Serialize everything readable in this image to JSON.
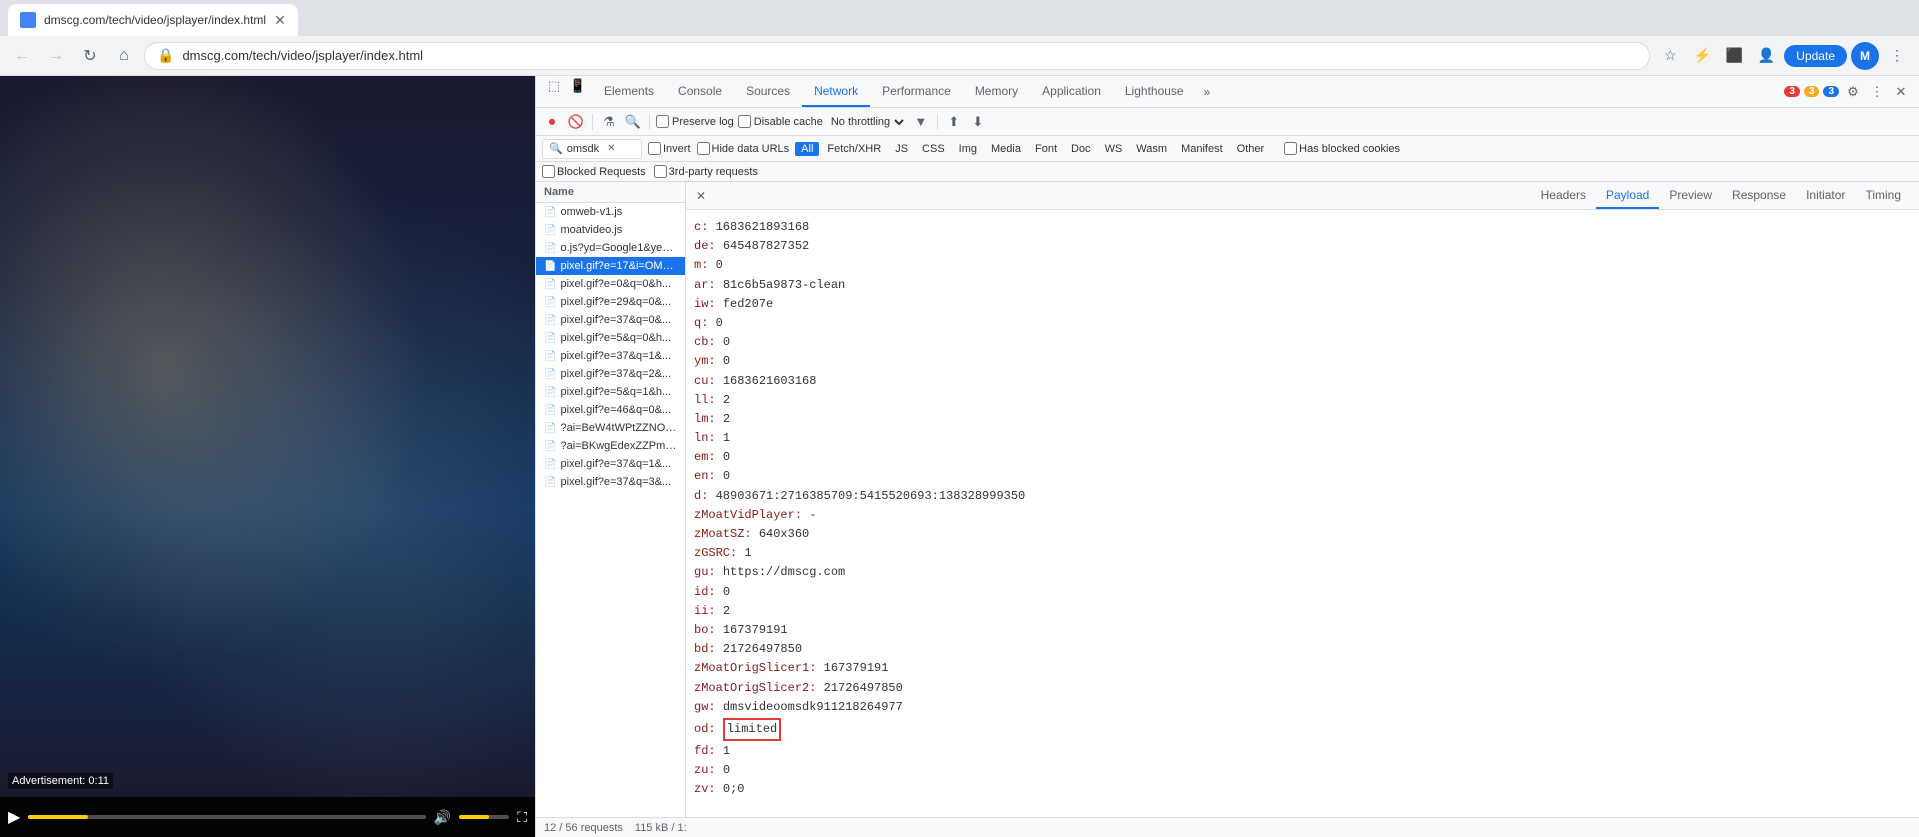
{
  "browser": {
    "tab_title": "dmscg.com/tech/video/jsplayer/index.html",
    "address": "dmscg.com/tech/video/jsplayer/index.html",
    "update_label": "Update",
    "avatar_initial": "M"
  },
  "devtools": {
    "tabs": [
      {
        "id": "elements",
        "label": "Elements",
        "active": false
      },
      {
        "id": "console",
        "label": "Console",
        "active": false
      },
      {
        "id": "sources",
        "label": "Sources",
        "active": false
      },
      {
        "id": "network",
        "label": "Network",
        "active": true
      },
      {
        "id": "performance",
        "label": "Performance",
        "active": false
      },
      {
        "id": "memory",
        "label": "Memory",
        "active": false
      },
      {
        "id": "application",
        "label": "Application",
        "active": false
      },
      {
        "id": "lighthouse",
        "label": "Lighthouse",
        "active": false
      }
    ],
    "toolbar": {
      "preserve_log": "Preserve log",
      "disable_cache": "Disable cache",
      "throttle": "No throttling",
      "blocked_requests": "Blocked Requests",
      "third_party": "3rd-party requests"
    },
    "filter": {
      "placeholder": "omsdk",
      "invert": "Invert",
      "hide_data_urls": "Hide data URLs",
      "filter_types": [
        "All",
        "Fetch/XHR",
        "JS",
        "CSS",
        "Img",
        "Media",
        "Font",
        "Doc",
        "WS",
        "Wasm",
        "Manifest",
        "Other"
      ],
      "active_filter": "All",
      "has_blocked": "Has blocked cookies"
    },
    "badges": {
      "errors": "3",
      "warnings": "3",
      "info": "3"
    },
    "file_list": {
      "header": "Name",
      "files": [
        {
          "name": "omweb-v1.js",
          "selected": false,
          "icon": "📄"
        },
        {
          "name": "moatvideo.js",
          "selected": false,
          "icon": "📄"
        },
        {
          "name": "o.js?yd=Google1&ye=...",
          "selected": false,
          "icon": "📄"
        },
        {
          "name": "pixel.gif?e=17&i=OMS...",
          "selected": true,
          "icon": "📄"
        },
        {
          "name": "pixel.gif?e=0&q=0&h...",
          "selected": false,
          "icon": "📄"
        },
        {
          "name": "pixel.gif?e=29&q=0&...",
          "selected": false,
          "icon": "📄"
        },
        {
          "name": "pixel.gif?e=37&q=0&...",
          "selected": false,
          "icon": "📄"
        },
        {
          "name": "pixel.gif?e=5&q=0&h...",
          "selected": false,
          "icon": "📄"
        },
        {
          "name": "pixel.gif?e=37&q=1&...",
          "selected": false,
          "icon": "📄"
        },
        {
          "name": "pixel.gif?e=37&q=2&...",
          "selected": false,
          "icon": "📄"
        },
        {
          "name": "pixel.gif?e=5&q=1&h...",
          "selected": false,
          "icon": "📄"
        },
        {
          "name": "pixel.gif?e=46&q=0&...",
          "selected": false,
          "icon": "📄"
        },
        {
          "name": "?ai=BeW4tWPtZZNOV...",
          "selected": false,
          "icon": "📄"
        },
        {
          "name": "?ai=BKwgEdexZZPmD...",
          "selected": false,
          "icon": "📄"
        },
        {
          "name": "pixel.gif?e=37&q=1&...",
          "selected": false,
          "icon": "📄"
        },
        {
          "name": "pixel.gif?e=37&q=3&...",
          "selected": false,
          "icon": "📄"
        }
      ]
    },
    "detail": {
      "tabs": [
        "Headers",
        "Payload",
        "Preview",
        "Response",
        "Initiator",
        "Timing"
      ],
      "active_tab": "Payload",
      "payload_data": [
        {
          "key": "c:",
          "value": "1683621893168"
        },
        {
          "key": "de:",
          "value": "645487827352"
        },
        {
          "key": "m:",
          "value": "0"
        },
        {
          "key": "ar:",
          "value": "81c6b5a9873-clean"
        },
        {
          "key": "iw:",
          "value": "fed207e"
        },
        {
          "key": "q:",
          "value": "0"
        },
        {
          "key": "cb:",
          "value": "0"
        },
        {
          "key": "ym:",
          "value": "0"
        },
        {
          "key": "cu:",
          "value": "1683621603168"
        },
        {
          "key": "ll:",
          "value": "2"
        },
        {
          "key": "lm:",
          "value": "2"
        },
        {
          "key": "ln:",
          "value": "1"
        },
        {
          "key": "em:",
          "value": "0"
        },
        {
          "key": "en:",
          "value": "0"
        },
        {
          "key": "d:",
          "value": "48903671:2716385709:5415520693:138328999350"
        },
        {
          "key": "zMoatVidPlayer:",
          "value": "-"
        },
        {
          "key": "zMoatSZ:",
          "value": "640x360"
        },
        {
          "key": "zGSRC:",
          "value": "1"
        },
        {
          "key": "gu:",
          "value": "https://dmscg.com"
        },
        {
          "key": "id:",
          "value": "0"
        },
        {
          "key": "ii:",
          "value": "2"
        },
        {
          "key": "bo:",
          "value": "167379191"
        },
        {
          "key": "bd:",
          "value": "21726497850"
        },
        {
          "key": "zMoatOrigSlicer1:",
          "value": "167379191"
        },
        {
          "key": "zMoatOrigSlicer2:",
          "value": "21726497850"
        },
        {
          "key": "gw:",
          "value": "dmsvideoomsdk911218264977"
        },
        {
          "key": "od:",
          "value": "limited",
          "highlight": true
        },
        {
          "key": "fd:",
          "value": "1"
        },
        {
          "key": "zu:",
          "value": "0"
        },
        {
          "key": "zv:",
          "value": "0;0"
        }
      ]
    },
    "status_bar": {
      "requests": "12 / 56 requests",
      "size": "115 kB / 1:"
    }
  },
  "video": {
    "ad_label": "Advertisement: 0:11"
  }
}
